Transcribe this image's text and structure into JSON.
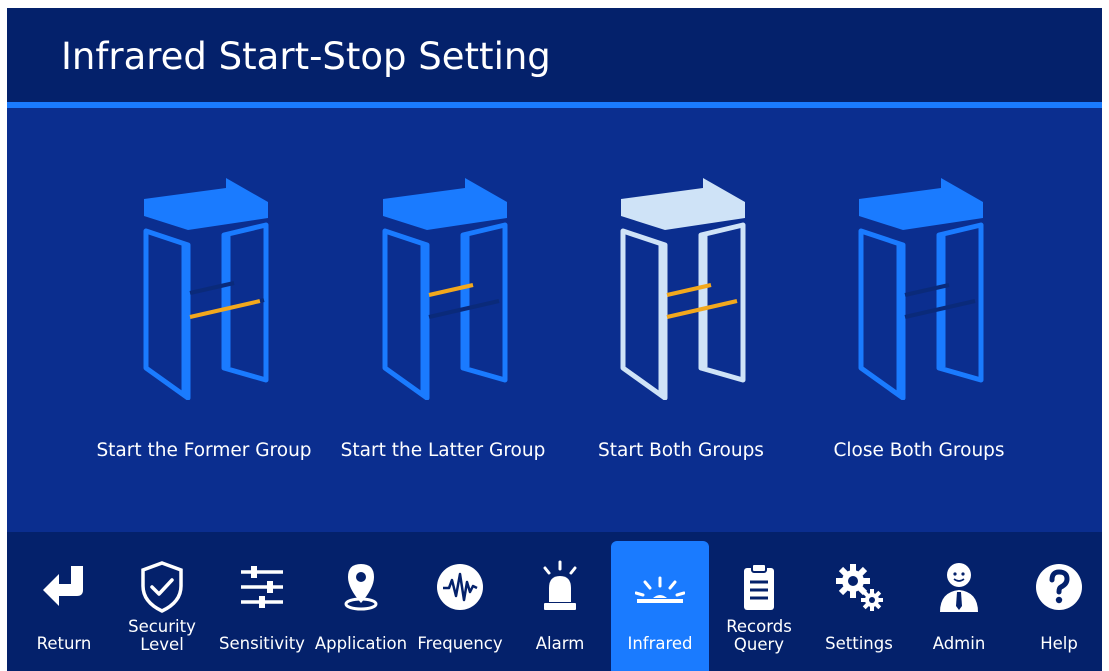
{
  "header": {
    "title": "Infrared Start-Stop Setting"
  },
  "options": [
    {
      "label": "Start the Former Group",
      "state": "former"
    },
    {
      "label": "Start the Latter Group",
      "state": "latter"
    },
    {
      "label": "Start Both Groups",
      "state": "both",
      "selected": true
    },
    {
      "label": "Close Both Groups",
      "state": "none"
    }
  ],
  "toolbar": {
    "items": [
      {
        "label": "Return",
        "icon": "return-icon"
      },
      {
        "label": "Security Level",
        "line1": "Security",
        "line2": "Level",
        "icon": "shield-check-icon"
      },
      {
        "label": "Sensitivity",
        "icon": "sliders-icon"
      },
      {
        "label": "Application",
        "icon": "location-pin-icon"
      },
      {
        "label": "Frequency",
        "icon": "waveform-icon"
      },
      {
        "label": "Alarm",
        "icon": "alarm-light-icon"
      },
      {
        "label": "Infrared",
        "icon": "infrared-icon",
        "active": true
      },
      {
        "label": "Records Query",
        "line1": "Records",
        "line2": "Query",
        "icon": "clipboard-icon"
      },
      {
        "label": "Settings",
        "icon": "gears-icon"
      },
      {
        "label": "Admin",
        "icon": "admin-person-icon"
      },
      {
        "label": "Help",
        "icon": "help-icon"
      }
    ]
  },
  "colors": {
    "background": "#0b2e8f",
    "header": "#04216b",
    "accent": "#1a7bff",
    "gate": "#1a7bff",
    "gate_selected": "#cfe3f7",
    "beam_on": "#f2a81d",
    "beam_off": "#0a2a7a"
  }
}
